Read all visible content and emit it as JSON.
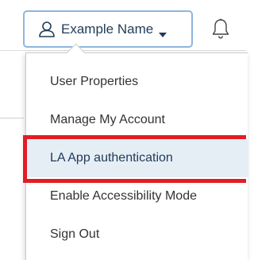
{
  "header": {
    "user_name": "Example Name",
    "user_icon": "user-icon",
    "caret_icon": "caret-down-icon",
    "notifications_icon": "bell-icon"
  },
  "user_menu": {
    "items": [
      {
        "label": "User Properties",
        "active": false
      },
      {
        "label": "Manage My Account",
        "active": false
      },
      {
        "label": "LA App authentication",
        "active": true
      },
      {
        "label": "Enable Accessibility Mode",
        "active": false
      },
      {
        "label": "Sign Out",
        "active": false
      }
    ]
  },
  "colors": {
    "button_border": "#8fb6dd",
    "active_item_bg": "#e6eef5",
    "highlight_annotation": "#e31c24",
    "text": "#333333"
  }
}
